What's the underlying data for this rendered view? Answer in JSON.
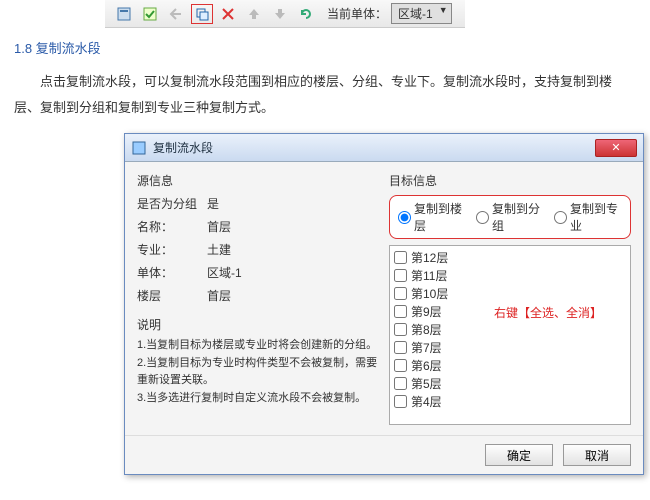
{
  "toolbar": {
    "label_current_unit": "当前单体：",
    "unit_select": "区域-1"
  },
  "doc": {
    "section_title": "1.8 复制流水段",
    "para1": "点击复制流水段，可以复制流水段范围到相应的楼层、分组、专业下。复制流水段时，支持复制到楼层、复制到分组和复制到专业三种复制方式。",
    "para_tail": "楼层、复制到分组和复制到专业三种复制方式。"
  },
  "dialog": {
    "title": "复制流水段",
    "source_title": "源信息",
    "src": {
      "is_group_label": "是否为分组",
      "is_group_value": "是",
      "name_label": "名称：",
      "name_value": "首层",
      "spec_label": "专业：",
      "spec_value": "土建",
      "unit_label": "单体：",
      "unit_value": "区域-1",
      "floor_label": "楼层",
      "floor_value": "首层"
    },
    "notes_title": "说明",
    "notes": [
      "1.当复制目标为楼层或专业时将会创建新的分组。",
      "2.当复制目标为专业时构件类型不会被复制，需要重新设置关联。",
      "3.当多选进行复制时自定义流水段不会被复制。"
    ],
    "target_title": "目标信息",
    "radios": {
      "r1": "复制到楼层",
      "r2": "复制到分组",
      "r3": "复制到专业"
    },
    "floors": [
      "第12层",
      "第11层",
      "第10层",
      "第9层",
      "第8层",
      "第7层",
      "第6层",
      "第5层",
      "第4层"
    ],
    "hint": "右键【全选、全消】",
    "ok": "确定",
    "cancel": "取消"
  }
}
